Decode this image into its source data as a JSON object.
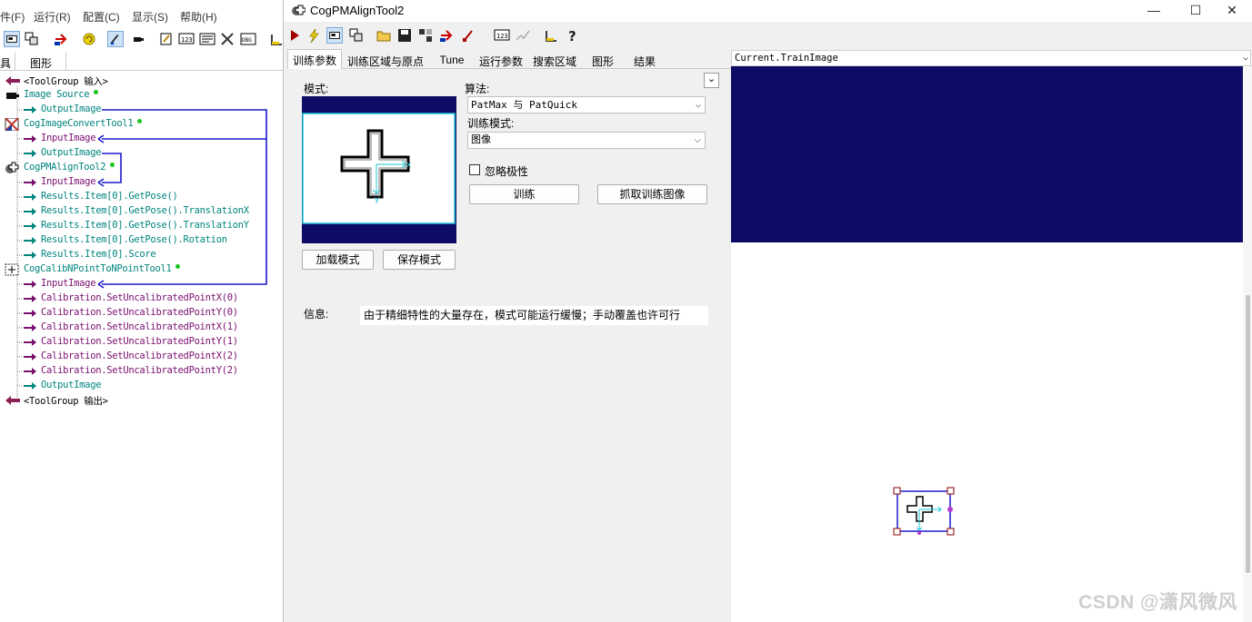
{
  "left": {
    "menu": [
      "件(F)",
      "运行(R)",
      "配置(C)",
      "显示(S)",
      "帮助(H)"
    ],
    "tabs": [
      "具",
      "图形"
    ],
    "tree": [
      {
        "label": "<ToolGroup 输入>",
        "color": "#000000",
        "level": 0,
        "icon": "tool-group-input-icon"
      },
      {
        "label": "Image Source",
        "color": "#00857f",
        "level": 1,
        "icon": "camera-icon",
        "dot": true
      },
      {
        "label": "OutputImage",
        "color": "#00857f",
        "level": 2,
        "icon": "output-arrow-icon"
      },
      {
        "label": "CogImageConvertTool1",
        "color": "#00857f",
        "level": 0,
        "icon": "image-convert-icon",
        "dot": true
      },
      {
        "label": "InputImage",
        "color": "#7a0f6f",
        "level": 2,
        "icon": "input-arrow-icon"
      },
      {
        "label": "OutputImage",
        "color": "#00857f",
        "level": 2,
        "icon": "output-arrow-icon"
      },
      {
        "label": "CogPMAlignTool2",
        "color": "#00857f",
        "level": 0,
        "icon": "pmalign-icon",
        "dot": true
      },
      {
        "label": "InputImage",
        "color": "#7a0f6f",
        "level": 2,
        "icon": "input-arrow-icon"
      },
      {
        "label": "Results.Item[0].GetPose()",
        "color": "#00857f",
        "level": 2,
        "icon": "output-arrow-icon"
      },
      {
        "label": "Results.Item[0].GetPose().TranslationX",
        "color": "#00857f",
        "level": 2,
        "icon": "output-arrow-icon"
      },
      {
        "label": "Results.Item[0].GetPose().TranslationY",
        "color": "#00857f",
        "level": 2,
        "icon": "output-arrow-icon"
      },
      {
        "label": "Results.Item[0].GetPose().Rotation",
        "color": "#00857f",
        "level": 2,
        "icon": "output-arrow-icon"
      },
      {
        "label": "Results.Item[0].Score",
        "color": "#00857f",
        "level": 2,
        "icon": "output-arrow-icon"
      },
      {
        "label": "CogCalibNPointToNPointTool1",
        "color": "#00857f",
        "level": 0,
        "icon": "calib-icon",
        "dot": true
      },
      {
        "label": "InputImage",
        "color": "#7a0f6f",
        "level": 2,
        "icon": "input-arrow-icon"
      },
      {
        "label": "Calibration.SetUncalibratedPointX(0)",
        "color": "#7a0f6f",
        "level": 2,
        "icon": "input-arrow-icon"
      },
      {
        "label": "Calibration.SetUncalibratedPointY(0)",
        "color": "#7a0f6f",
        "level": 2,
        "icon": "input-arrow-icon"
      },
      {
        "label": "Calibration.SetUncalibratedPointX(1)",
        "color": "#7a0f6f",
        "level": 2,
        "icon": "input-arrow-icon"
      },
      {
        "label": "Calibration.SetUncalibratedPointY(1)",
        "color": "#7a0f6f",
        "level": 2,
        "icon": "input-arrow-icon"
      },
      {
        "label": "Calibration.SetUncalibratedPointX(2)",
        "color": "#7a0f6f",
        "level": 2,
        "icon": "input-arrow-icon"
      },
      {
        "label": "Calibration.SetUncalibratedPointY(2)",
        "color": "#7a0f6f",
        "level": 2,
        "icon": "input-arrow-icon"
      },
      {
        "label": "OutputImage",
        "color": "#00857f",
        "level": 2,
        "icon": "output-arrow-icon"
      },
      {
        "label": "<ToolGroup 输出>",
        "color": "#000000",
        "level": 0,
        "icon": "tool-group-output-icon"
      }
    ]
  },
  "window": {
    "title": "CogPMAlignTool2",
    "controls": {
      "minimize": "—",
      "maximize": "☐",
      "close": "✕"
    }
  },
  "tabs": [
    "训练参数",
    "训练区域与原点",
    "Tune",
    "运行参数",
    "搜索区域",
    "图形",
    "结果"
  ],
  "train": {
    "pattern_label": "模式:",
    "algorithm_label": "算法:",
    "algorithm_value": "PatMax 与 PatQuick",
    "train_mode_label": "训练模式:",
    "train_mode_value": "图像",
    "ignore_polarity_label": "忽略极性",
    "ignore_polarity_checked": false,
    "train_button": "训练",
    "grab_button": "抓取训练图像",
    "load_button": "加载模式",
    "save_button": "保存模式",
    "info_label": "信息:",
    "info_text": "由于精细特性的大量存在，模式可能运行缓慢；手动覆盖也许可行",
    "collapse_glyph": "⌄"
  },
  "display": {
    "image_selector": "Current.TrainImage",
    "watermark": "CSDN @潇风微风"
  },
  "colors": {
    "navy": "#0c0c66",
    "teal": "#00857f",
    "purple": "#7a0f6f",
    "link_line": "#1a1acc",
    "status_dot": "#1cc41c"
  }
}
